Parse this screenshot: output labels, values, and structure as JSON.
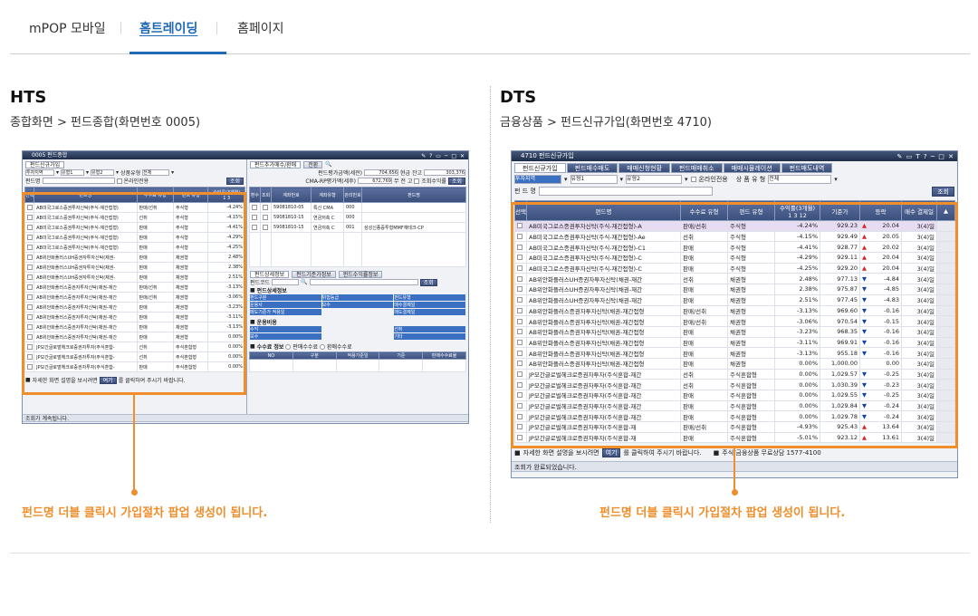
{
  "tabs": [
    {
      "label": "mPOP 모바일"
    },
    {
      "label": "홈트레이딩"
    },
    {
      "label": "홈페이지"
    }
  ],
  "hts": {
    "title": "HTS",
    "subtitle": "종합화면 > 펀드종합(화면번호 0005)",
    "caption": "펀드명 더블 클릭시 가입절차 팝업 생성이 됩니다.",
    "window_title": "0005 펀드종합",
    "tab_join": "펀드신규가입",
    "filter1": "투자지역",
    "filter2": "유형1",
    "filter3": "유형2",
    "filter4_label": "상품유형",
    "filter4_value": "전체",
    "fund_name_label": "펀드명",
    "online_only": "온라인전용",
    "search_btn": "조회",
    "headers": [
      "선택",
      "펀드명",
      "수수료 유형",
      "펀드 유형",
      "수익률(3개월)"
    ],
    "period_btns": [
      "1",
      "3"
    ],
    "rows": [
      {
        "name": "AB미국그로스증권투자신탁(주식-재간접형)",
        "fee": "판매/선취",
        "type": "주식형",
        "rate": "-4.24%"
      },
      {
        "name": "AB미국그로스증권투자신탁(주식-재간접형)",
        "fee": "선취",
        "type": "주식형",
        "rate": "-4.15%"
      },
      {
        "name": "AB미국그로스증권투자신탁(주식-재간접형)",
        "fee": "판매",
        "type": "주식형",
        "rate": "-4.41%"
      },
      {
        "name": "AB미국그로스증권투자신탁(주식-재간접형)",
        "fee": "판매",
        "type": "주식형",
        "rate": "-4.29%"
      },
      {
        "name": "AB미국그로스증권투자신탁(주식-재간접형)",
        "fee": "판매",
        "type": "주식형",
        "rate": "-4.25%"
      },
      {
        "name": "AB위안화플러스UH증권자투자신탁(채권-",
        "fee": "판매",
        "type": "채권형",
        "rate": "2.48%"
      },
      {
        "name": "AB위안화플러스UH증권자투자신탁(채권-",
        "fee": "판매",
        "type": "채권형",
        "rate": "2.38%"
      },
      {
        "name": "AB위안화플러스UH증권자투자신탁(채권-",
        "fee": "판매",
        "type": "채권형",
        "rate": "2.51%"
      },
      {
        "name": "AB위안화플러스증권자투자신탁(채권-재간",
        "fee": "판매/선취",
        "type": "채권형",
        "rate": "-3.13%"
      },
      {
        "name": "AB위안화플러스증권자투자신탁(채권-재간",
        "fee": "판매/선취",
        "type": "채권형",
        "rate": "-3.06%"
      },
      {
        "name": "AB위안화플러스증권자투자신탁(채권-재간",
        "fee": "판매",
        "type": "채권형",
        "rate": "-3.23%"
      },
      {
        "name": "AB위안화플러스증권자투자신탁(채권-재간",
        "fee": "판매",
        "type": "채권형",
        "rate": "-3.11%"
      },
      {
        "name": "AB위안화플러스증권자투자신탁(채권-재간",
        "fee": "판매",
        "type": "채권형",
        "rate": "-3.13%"
      },
      {
        "name": "AB위안화플러스증권자투자신탁(채권-재간",
        "fee": "판매",
        "type": "채권형",
        "rate": "0.00%"
      },
      {
        "name": "JP모간글로벌헤크로증권자투자(주식혼합-",
        "fee": "선취",
        "type": "주식혼합형",
        "rate": "0.00%"
      },
      {
        "name": "JP모간글로벌헤크로증권자투자(주식혼합-",
        "fee": "선취",
        "type": "주식혼합형",
        "rate": "0.00%"
      },
      {
        "name": "JP모간글로벌헤크로증권자투자(주식혼합-",
        "fee": "판매",
        "type": "주식혼합형",
        "rate": "0.00%"
      }
    ],
    "notice_prefix": "자세한 화면 설명을 보시려면",
    "notice_link": "여기",
    "notice_suffix": "를 클릭하여 주시기 바랍니다.",
    "status": "조회가 계속됩니다.",
    "right": {
      "tab1": "펀드추가매수/환매",
      "tab2": "전환",
      "label1": "펀드평가금액(세전)",
      "value1": "704,656",
      "label1b": "현금 잔고",
      "value1b": "303,376",
      "label2": "CMA-RP평가액(세후)",
      "value2": "672,769",
      "label2b": "무 전 고",
      "radio1": "조회수익률",
      "headers": [
        "환수",
        "조회",
        "계좌번호",
        "계좌유형",
        "관리번호",
        "펀드명"
      ],
      "rows": [
        {
          "acct": "59081810-05",
          "kind": "특신 CMA",
          "no": "000",
          "name": ""
        },
        {
          "acct": "59081810-15",
          "kind": "연금저축 C",
          "no": "000",
          "name": ""
        },
        {
          "acct": "59081810-15",
          "kind": "연금저축 C",
          "no": "001",
          "name": "삼성신종증투형MMF재테크-CP"
        }
      ],
      "subtabs": [
        "펀드상세정보",
        "펀드기준가정보",
        "펀드수익률정보"
      ],
      "fund_code_label": "펀드코드",
      "basic_info": "펀드상세정보",
      "info_labels": [
        "펀드구분",
        "위험등급",
        "펀드유형",
        "운용사",
        "보수",
        "매수결제일",
        "매도기준가 적용일",
        "매도결제일"
      ],
      "sales_info": "운용비용",
      "sales_labels": [
        "수익",
        "보수",
        "선취",
        "보수",
        "기타"
      ],
      "fee_info": "수수료 정보",
      "fee_radio1": "판매수수료",
      "fee_radio2": "환매수수료",
      "fee_headers": [
        "NO",
        "구분",
        "적용기준일",
        "기준",
        "판매수수료율"
      ]
    }
  },
  "dts": {
    "title": "DTS",
    "subtitle": "금융상품 > 펀드신규가입(화면번호 4710)",
    "caption": "펀드명 더블 클릭시 가입절차 팝업 생성이 됩니다.",
    "window_title": "4710 펀드신규가입",
    "tabs": [
      "펀드신규가입",
      "펀드매수매도",
      "매매신청현황",
      "펀드매매취소",
      "매매시뮬레이션",
      "펀드매도내역"
    ],
    "filter1": "투자지역",
    "filter2": "유형1",
    "filter3": "유형2",
    "online_only": "온라인전용",
    "product_type_label": "상 품 유 형",
    "product_type_value": "전체",
    "fund_name_label": "펀 드 명",
    "search_btn": "조회",
    "headers": [
      "선택",
      "펀드명",
      "수수료 유형",
      "펀드 유형",
      "수익률(3개월)",
      "기준가",
      "등락",
      "매수 결제일"
    ],
    "period_btns": [
      "1",
      "3",
      "12"
    ],
    "rows": [
      {
        "name": "AB미국그로스증권투자신탁(주식-재간접형)-A",
        "fee": "판매/선취",
        "type": "주식형",
        "rate": "-4.24%",
        "price": "929.23",
        "dir": "up",
        "chg": "20.04",
        "settle": "3(4)일"
      },
      {
        "name": "AB미국그로스증권투자신탁(주식-재간접형)-Ae",
        "fee": "선취",
        "type": "주식형",
        "rate": "-4.15%",
        "price": "929.49",
        "dir": "up",
        "chg": "20.05",
        "settle": "3(4)일"
      },
      {
        "name": "AB미국그로스증권투자신탁(주식-재간접형)-C1",
        "fee": "판매",
        "type": "주식형",
        "rate": "-4.41%",
        "price": "928.77",
        "dir": "up",
        "chg": "20.02",
        "settle": "3(4)일"
      },
      {
        "name": "AB미국그로스증권투자신탁(주식-재간접형)-C",
        "fee": "판매",
        "type": "주식형",
        "rate": "-4.29%",
        "price": "929.11",
        "dir": "up",
        "chg": "20.04",
        "settle": "3(4)일"
      },
      {
        "name": "AB미국그로스증권투자신탁(주식-재간접형)-C",
        "fee": "판매",
        "type": "주식형",
        "rate": "-4.25%",
        "price": "929.20",
        "dir": "up",
        "chg": "20.04",
        "settle": "3(4)일"
      },
      {
        "name": "AB위안화플러스UH증권자투자신탁(채권-재간",
        "fee": "선취",
        "type": "채권형",
        "rate": "2.48%",
        "price": "977.13",
        "dir": "dn",
        "chg": "-4.84",
        "settle": "3(4)일"
      },
      {
        "name": "AB위안화플러스UH증권자투자신탁(채권-재간",
        "fee": "판매",
        "type": "채권형",
        "rate": "2.38%",
        "price": "975.87",
        "dir": "dn",
        "chg": "-4.85",
        "settle": "3(4)일"
      },
      {
        "name": "AB위안화플러스UH증권자투자신탁(채권-재간",
        "fee": "판매",
        "type": "채권형",
        "rate": "2.51%",
        "price": "977.45",
        "dir": "dn",
        "chg": "-4.83",
        "settle": "3(4)일"
      },
      {
        "name": "AB위안화플러스증권자투자신탁(채권-재간접형",
        "fee": "판매/선취",
        "type": "채권형",
        "rate": "-3.13%",
        "price": "969.60",
        "dir": "dn",
        "chg": "-0.16",
        "settle": "3(4)일"
      },
      {
        "name": "AB위안화플러스증권자투자신탁(채권-재간접형",
        "fee": "판매/선취",
        "type": "채권형",
        "rate": "-3.06%",
        "price": "970.54",
        "dir": "dn",
        "chg": "-0.15",
        "settle": "3(4)일"
      },
      {
        "name": "AB위안화플러스증권자투자신탁(채권-재간접형",
        "fee": "판매",
        "type": "채권형",
        "rate": "-3.23%",
        "price": "968.35",
        "dir": "dn",
        "chg": "-0.16",
        "settle": "3(4)일"
      },
      {
        "name": "AB위안화플러스증권자투자신탁(채권-재간접형",
        "fee": "판매",
        "type": "채권형",
        "rate": "-3.11%",
        "price": "969.91",
        "dir": "dn",
        "chg": "-0.16",
        "settle": "3(4)일"
      },
      {
        "name": "AB위안화플러스증권자투자신탁(채권-재간접형",
        "fee": "판매",
        "type": "채권형",
        "rate": "-3.13%",
        "price": "955.18",
        "dir": "dn",
        "chg": "-0.16",
        "settle": "3(4)일"
      },
      {
        "name": "AB위안화플러스증권자투자신탁(채권-재간접형",
        "fee": "판매",
        "type": "채권형",
        "rate": "0.00%",
        "price": "1,000.00",
        "dir": "",
        "chg": "0.00",
        "settle": "3(4)일"
      },
      {
        "name": "JP모간글로벌헤크로증권자투자(주식혼합-재간",
        "fee": "선취",
        "type": "주식혼합형",
        "rate": "0.00%",
        "price": "1,029.57",
        "dir": "dn",
        "chg": "-0.25",
        "settle": "3(4)일"
      },
      {
        "name": "JP모간글로벌헤크로증권자투자(주식혼합-재간",
        "fee": "선취",
        "type": "주식혼합형",
        "rate": "0.00%",
        "price": "1,030.39",
        "dir": "dn",
        "chg": "-0.23",
        "settle": "3(4)일"
      },
      {
        "name": "JP모간글로벌헤크로증권자투자(주식혼합-재간",
        "fee": "판매",
        "type": "주식혼합형",
        "rate": "0.00%",
        "price": "1,029.55",
        "dir": "dn",
        "chg": "-0.25",
        "settle": "3(4)일"
      },
      {
        "name": "JP모간글로벌헤크로증권자투자(주식혼합-재간",
        "fee": "판매",
        "type": "주식혼합형",
        "rate": "0.00%",
        "price": "1,029.84",
        "dir": "dn",
        "chg": "-0.24",
        "settle": "3(4)일"
      },
      {
        "name": "JP모간글로벌헤크로증권자투자(주식혼합-재간",
        "fee": "판매",
        "type": "주식혼합형",
        "rate": "0.00%",
        "price": "1,029.78",
        "dir": "dn",
        "chg": "-0.24",
        "settle": "3(4)일"
      },
      {
        "name": "JP모간글로벌헤크로증권자투자(주식혼합-재",
        "fee": "판매/선취",
        "type": "주식혼합형",
        "rate": "-4.93%",
        "price": "925.43",
        "dir": "up",
        "chg": "13.64",
        "settle": "3(4)일"
      },
      {
        "name": "JP모간글로벌헤크로증권자투자(주식혼합-재",
        "fee": "판매",
        "type": "주식혼합형",
        "rate": "-5.01%",
        "price": "923.12",
        "dir": "up",
        "chg": "13.61",
        "settle": "3(4)일"
      }
    ],
    "notice_prefix": "자세한 화면 설명을 보시려면",
    "notice_link": "여기",
    "notice_suffix": "를 클릭하여 주시기 바랍니다.",
    "notice2": "주식/금융상품 무료상담 1577-4100",
    "status": "조회가 완료되었습니다."
  },
  "colors": {
    "accent": "#1f69b5",
    "highlight": "#ef8e2a",
    "header": "#3b4f7c",
    "up": "#d22222",
    "down": "#1140b0"
  }
}
